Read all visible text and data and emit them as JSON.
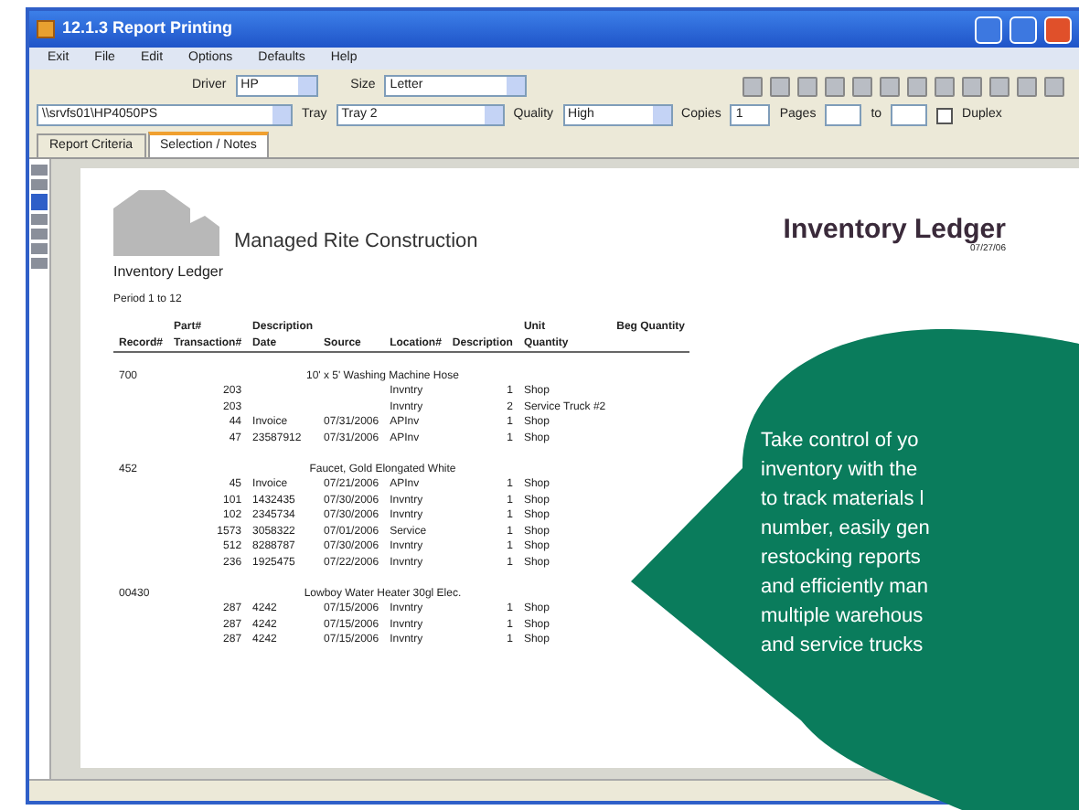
{
  "window": {
    "title": "12.1.3 Report Printing"
  },
  "menu": [
    "Exit",
    "File",
    "Edit",
    "Options",
    "Defaults",
    "Help"
  ],
  "print_options": {
    "driver_label": "Driver",
    "driver": "HP",
    "size_label": "Size",
    "size": "Letter",
    "printer": "\\\\srvfs01\\HP4050PS",
    "tray_label": "Tray",
    "tray": "Tray 2",
    "quality_label": "Quality",
    "quality": "High",
    "copies_label": "Copies",
    "copies": "1",
    "pages_label": "Pages",
    "to_label": "to",
    "duplex_label": "Duplex",
    "duplex": false
  },
  "tabs": [
    {
      "label": "Report Criteria",
      "selected": false
    },
    {
      "label": "Selection / Notes",
      "selected": true
    }
  ],
  "thumbnails": [
    {
      "selected": false
    },
    {
      "selected": false
    },
    {
      "selected": true
    },
    {
      "selected": false
    },
    {
      "selected": false
    },
    {
      "selected": false
    },
    {
      "selected": false
    }
  ],
  "report": {
    "company": "Managed Rite Construction",
    "title": "Inventory Ledger",
    "date": "07/27/06",
    "subtitle": "Inventory Ledger",
    "period": "Period 1 to 12",
    "columns": [
      {
        "bottom": "Record#"
      },
      {
        "top": "Part#",
        "bottom": "Transaction#"
      },
      {
        "top": "Description",
        "bottom": "Date"
      },
      {
        "bottom": "Source"
      },
      {
        "bottom": "Location#"
      },
      {
        "bottom": "Description"
      },
      {
        "top": "Unit",
        "bottom": "Quantity"
      },
      {
        "top": "Beg Quantity"
      }
    ],
    "groups": [
      {
        "record": "700",
        "description": "10' x 5' Washing Machine Hose",
        "rows": [
          [
            "203",
            "",
            "",
            "Invntry",
            "1",
            "Shop"
          ],
          [
            "203",
            "",
            "",
            "Invntry",
            "2",
            "Service Truck #2"
          ],
          [
            "44",
            "Invoice",
            "07/31/2006",
            "APInv",
            "1",
            "Shop"
          ],
          [
            "47",
            "23587912",
            "07/31/2006",
            "APInv",
            "1",
            "Shop"
          ]
        ]
      },
      {
        "record": "452",
        "description": "Faucet, Gold Elongated White",
        "rows": [
          [
            "45",
            "Invoice",
            "07/21/2006",
            "APInv",
            "1",
            "Shop"
          ],
          [
            "101",
            "1432435",
            "07/30/2006",
            "Invntry",
            "1",
            "Shop"
          ],
          [
            "102",
            "2345734",
            "07/30/2006",
            "Invntry",
            "1",
            "Shop"
          ],
          [
            "1573",
            "3058322",
            "07/01/2006",
            "Service",
            "1",
            "Shop"
          ],
          [
            "512",
            "8288787",
            "07/30/2006",
            "Invntry",
            "1",
            "Shop"
          ],
          [
            "236",
            "1925475",
            "07/22/2006",
            "Invntry",
            "1",
            "Shop"
          ]
        ]
      },
      {
        "record": "00430",
        "description": "Lowboy Water Heater 30gl Elec.",
        "rows": [
          [
            "287",
            "4242",
            "07/15/2006",
            "Invntry",
            "1",
            "Shop"
          ],
          [
            "287",
            "4242",
            "07/15/2006",
            "Invntry",
            "1",
            "Shop"
          ],
          [
            "287",
            "4242",
            "07/15/2006",
            "Invntry",
            "1",
            "Shop"
          ]
        ]
      }
    ]
  },
  "callout": {
    "lines": [
      "Take control of yo",
      "inventory with the",
      "to track materials l",
      "number, easily gen",
      "restocking reports",
      "and efficiently man",
      "multiple warehous",
      "and service trucks"
    ]
  }
}
